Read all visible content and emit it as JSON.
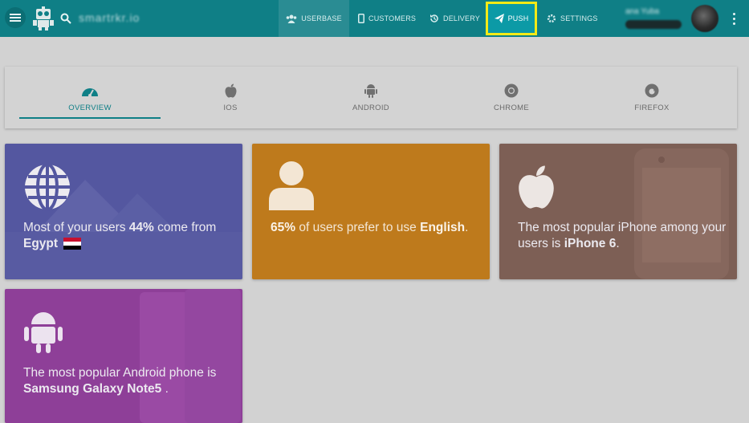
{
  "header": {
    "app_name": "smartrkr.io",
    "nav": [
      {
        "label": "USERBASE",
        "icon": "users-icon"
      },
      {
        "label": "CUSTOMERS",
        "icon": "phone-icon"
      },
      {
        "label": "DELIVERY",
        "icon": "history-icon"
      },
      {
        "label": "PUSH",
        "icon": "paper-plane-icon"
      },
      {
        "label": "SETTINGS",
        "icon": "gear-icon"
      }
    ],
    "user": {
      "name": "ana Yuba"
    }
  },
  "tabs": [
    {
      "label": "OVERVIEW",
      "icon": "dashboard-icon",
      "active": true
    },
    {
      "label": "IOS",
      "icon": "apple-icon",
      "active": false
    },
    {
      "label": "ANDROID",
      "icon": "android-icon",
      "active": false
    },
    {
      "label": "CHROME",
      "icon": "chrome-icon",
      "active": false
    },
    {
      "label": "FIREFOX",
      "icon": "firefox-icon",
      "active": false
    }
  ],
  "cards": {
    "country": {
      "prefix": "Most of your users ",
      "percent": "44%",
      "middle": " come from ",
      "country": "Egypt"
    },
    "language": {
      "percent": "65%",
      "middle": " of users prefer to use ",
      "language": "English",
      "suffix": "."
    },
    "iphone": {
      "prefix": "The most popular iPhone among your users is ",
      "device": "iPhone 6",
      "suffix": "."
    },
    "android": {
      "prefix": "The most popular Android phone is ",
      "device": "Samsung Galaxy Note5",
      "suffix": " ."
    }
  },
  "colors": {
    "header": "#0f7f86",
    "push_highlight": "#f4ea16",
    "card_country": "#5457a0",
    "card_language": "#be7a1c",
    "card_iphone": "#7d5f55",
    "card_android": "#8e3f98"
  }
}
